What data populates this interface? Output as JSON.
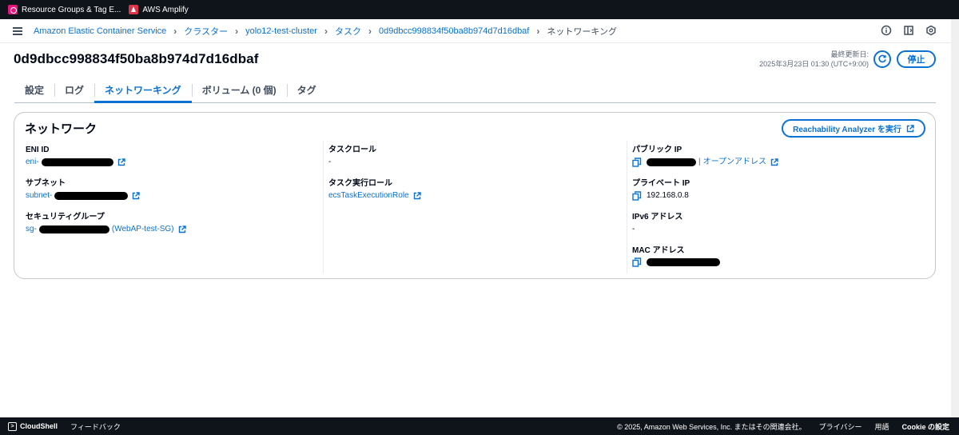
{
  "bookmarks": [
    {
      "label": "Resource Groups & Tag E...",
      "icon": "resource-groups-icon"
    },
    {
      "label": "AWS Amplify",
      "icon": "amplify-icon"
    }
  ],
  "breadcrumb": {
    "items": [
      "Amazon Elastic Container Service",
      "クラスター",
      "yolo12-test-cluster",
      "タスク",
      "0d9dbcc998834f50ba8b974d7d16dbaf"
    ],
    "current": "ネットワーキング"
  },
  "header": {
    "title": "0d9dbcc998834f50ba8b974d7d16dbaf",
    "last_updated_label": "最終更新日:",
    "last_updated_value": "2025年3月23日 01:30 (UTC+9:00)",
    "stop_label": "停止"
  },
  "tabs": [
    {
      "label": "設定"
    },
    {
      "label": "ログ"
    },
    {
      "label": "ネットワーキング",
      "active": true
    },
    {
      "label": "ボリューム (0 個)"
    },
    {
      "label": "タグ"
    }
  ],
  "network": {
    "title": "ネットワーク",
    "reachability_label": "Reachability Analyzer を実行",
    "eni": {
      "label": "ENI ID",
      "prefix": "eni-"
    },
    "subnet": {
      "label": "サブネット",
      "prefix": "subnet-"
    },
    "security_group": {
      "label": "セキュリティグループ",
      "prefix": "sg-",
      "name": "(WebAP-test-SG)"
    },
    "task_role": {
      "label": "タスクロール",
      "value": "-"
    },
    "task_exec_role": {
      "label": "タスク実行ロール",
      "value": "ecsTaskExecutionRole"
    },
    "public_ip": {
      "label": "パブリック IP",
      "open_address": "オープンアドレス"
    },
    "private_ip": {
      "label": "プライベート IP",
      "value": "192.168.0.8"
    },
    "ipv6": {
      "label": "IPv6 アドレス",
      "value": "-"
    },
    "mac": {
      "label": "MAC アドレス"
    }
  },
  "footer": {
    "cloudshell": "CloudShell",
    "feedback": "フィードバック",
    "copyright": "© 2025, Amazon Web Services, Inc. またはその関連会社。",
    "privacy": "プライバシー",
    "terms": "用語",
    "cookie": "Cookie の設定"
  },
  "colors": {
    "link": "#0972d3",
    "dark": "#0f141a",
    "text": "#000716"
  }
}
